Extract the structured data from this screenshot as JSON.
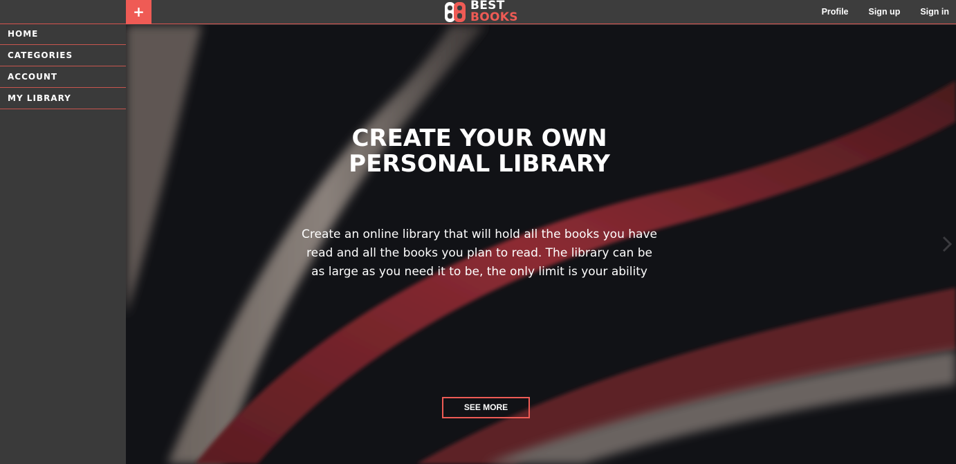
{
  "header": {
    "plus_label": "+",
    "logo_word1": "BEST",
    "logo_word2": "BOOKS",
    "nav": [
      {
        "label": "Profile"
      },
      {
        "label": "Sign up"
      },
      {
        "label": "Sign in"
      }
    ]
  },
  "sidebar": {
    "items": [
      {
        "label": "HOME"
      },
      {
        "label": "CATEGORIES"
      },
      {
        "label": "ACCOUNT"
      },
      {
        "label": "MY LIBRARY"
      }
    ]
  },
  "hero": {
    "title_line1": "CREATE YOUR OWN",
    "title_line2": "PERSONAL LIBRARY",
    "text": "Create an online library that will hold all the books you have read and all the books you plan to read. The library can be as large as you need it to be, the only limit is your ability",
    "button_label": "SEE MORE"
  },
  "icons": {
    "plus": "plus-icon",
    "logo": "books-logo-icon",
    "next": "chevron-right-icon"
  },
  "colors": {
    "accent": "#ef5b55",
    "sidebar_bg": "#3a3a3a",
    "header_bg": "#3d3d3d",
    "hero_bg": "#111216",
    "text": "#ffffff"
  }
}
